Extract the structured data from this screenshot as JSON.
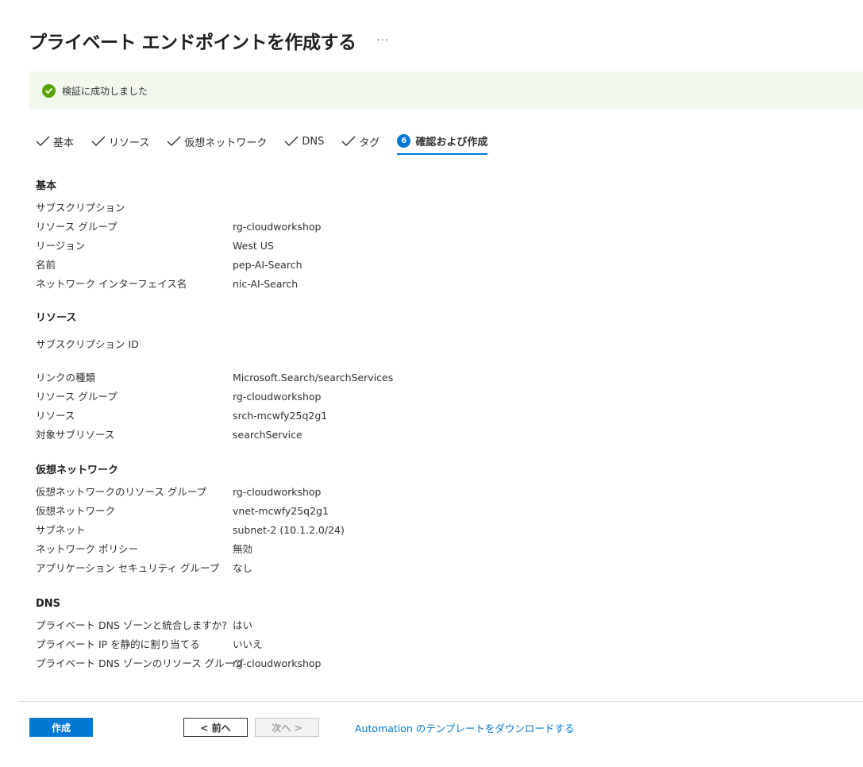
{
  "header": {
    "title": "プライベート エンドポイントを作成する",
    "more_label": "···"
  },
  "banner": {
    "text": "検証に成功しました",
    "icon": "check-circle-icon",
    "color": "#57a300"
  },
  "tabs": [
    {
      "label": "基本",
      "state": "done"
    },
    {
      "label": "リソース",
      "state": "done"
    },
    {
      "label": "仮想ネットワーク",
      "state": "done"
    },
    {
      "label": "DNS",
      "state": "done"
    },
    {
      "label": "タグ",
      "state": "done"
    },
    {
      "label": "確認および作成",
      "step": "6",
      "state": "active"
    }
  ],
  "sections": {
    "basics": {
      "title": "基本",
      "rows": [
        {
          "label": "サブスクリプション",
          "value": ""
        },
        {
          "label": "リソース グループ",
          "value": "rg-cloudworkshop"
        },
        {
          "label": "リージョン",
          "value": "West US"
        },
        {
          "label": "名前",
          "value": "pep-AI-Search"
        },
        {
          "label": "ネットワーク インターフェイス名",
          "value": "nic-AI-Search"
        }
      ]
    },
    "resource": {
      "title": "リソース",
      "rows": [
        {
          "label": "サブスクリプション ID",
          "value": ""
        },
        {
          "label": "リンクの種類",
          "value": "Microsoft.Search/searchServices"
        },
        {
          "label": "リソース グループ",
          "value": "rg-cloudworkshop"
        },
        {
          "label": "リソース",
          "value": "srch-mcwfy25q2g1"
        },
        {
          "label": "対象サブリソース",
          "value": "searchService"
        }
      ]
    },
    "vnet": {
      "title": "仮想ネットワーク",
      "rows": [
        {
          "label": "仮想ネットワークのリソース グループ",
          "value": "rg-cloudworkshop"
        },
        {
          "label": "仮想ネットワーク",
          "value": "vnet-mcwfy25q2g1"
        },
        {
          "label": "サブネット",
          "value": "subnet-2 (10.1.2.0/24)"
        },
        {
          "label": "ネットワーク ポリシー",
          "value": "無効"
        },
        {
          "label": "アプリケーション セキュリティ グループ",
          "value": "なし"
        }
      ]
    },
    "dns": {
      "title": "DNS",
      "rows": [
        {
          "label": "プライベート DNS ゾーンと統合しますか?",
          "value": "はい"
        },
        {
          "label": "プライベート IP を静的に割り当てる",
          "value": "いいえ"
        },
        {
          "label": "プライベート DNS ゾーンのリソース グループ",
          "value": "rg-cloudworkshop"
        }
      ]
    }
  },
  "footer": {
    "create_label": "作成",
    "prev_label": "< 前へ",
    "next_label": "次へ >",
    "download_label": "Automation のテンプレートをダウンロードする"
  },
  "colors": {
    "accent": "#0078d4",
    "success": "#57a300",
    "banner_bg": "#f1f8ee"
  }
}
